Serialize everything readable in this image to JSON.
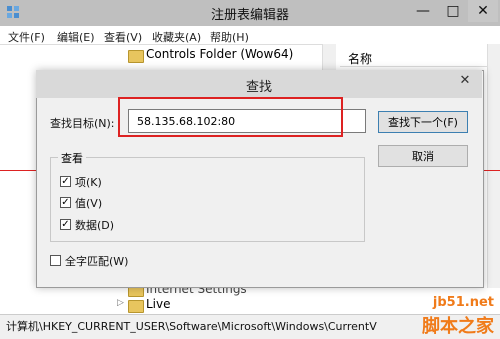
{
  "window": {
    "title": "注册表编辑器",
    "minimize": "—",
    "maximize": "□",
    "close": "✕"
  },
  "menu": [
    "文件(F)",
    "编辑(E)",
    "查看(V)",
    "收藏夹(A)",
    "帮助(H)"
  ],
  "tree": {
    "items": [
      "Controls Folder (Wow64)",
      "Internet Settings",
      "Live"
    ]
  },
  "list": {
    "header": "名称"
  },
  "status": {
    "path": "计算机\\HKEY_CURRENT_USER\\Software\\Microsoft\\Windows\\CurrentV"
  },
  "dialog": {
    "title": "查找",
    "close": "✕",
    "target_label": "查找目标(N):",
    "target_value": "58.135.68.102:80",
    "find_next": "查找下一个(F)",
    "cancel": "取消",
    "group_title": "查看",
    "options": [
      {
        "label": "项(K)",
        "checked": true
      },
      {
        "label": "值(V)",
        "checked": true
      },
      {
        "label": "数据(D)",
        "checked": true
      }
    ],
    "whole_match": {
      "label": "全字匹配(W)",
      "checked": false
    }
  },
  "watermark": {
    "line1": "jb51.net",
    "line2": "脚本之家"
  },
  "colors": {
    "highlight": "#dd2222",
    "watermark": "#f07b1a"
  }
}
